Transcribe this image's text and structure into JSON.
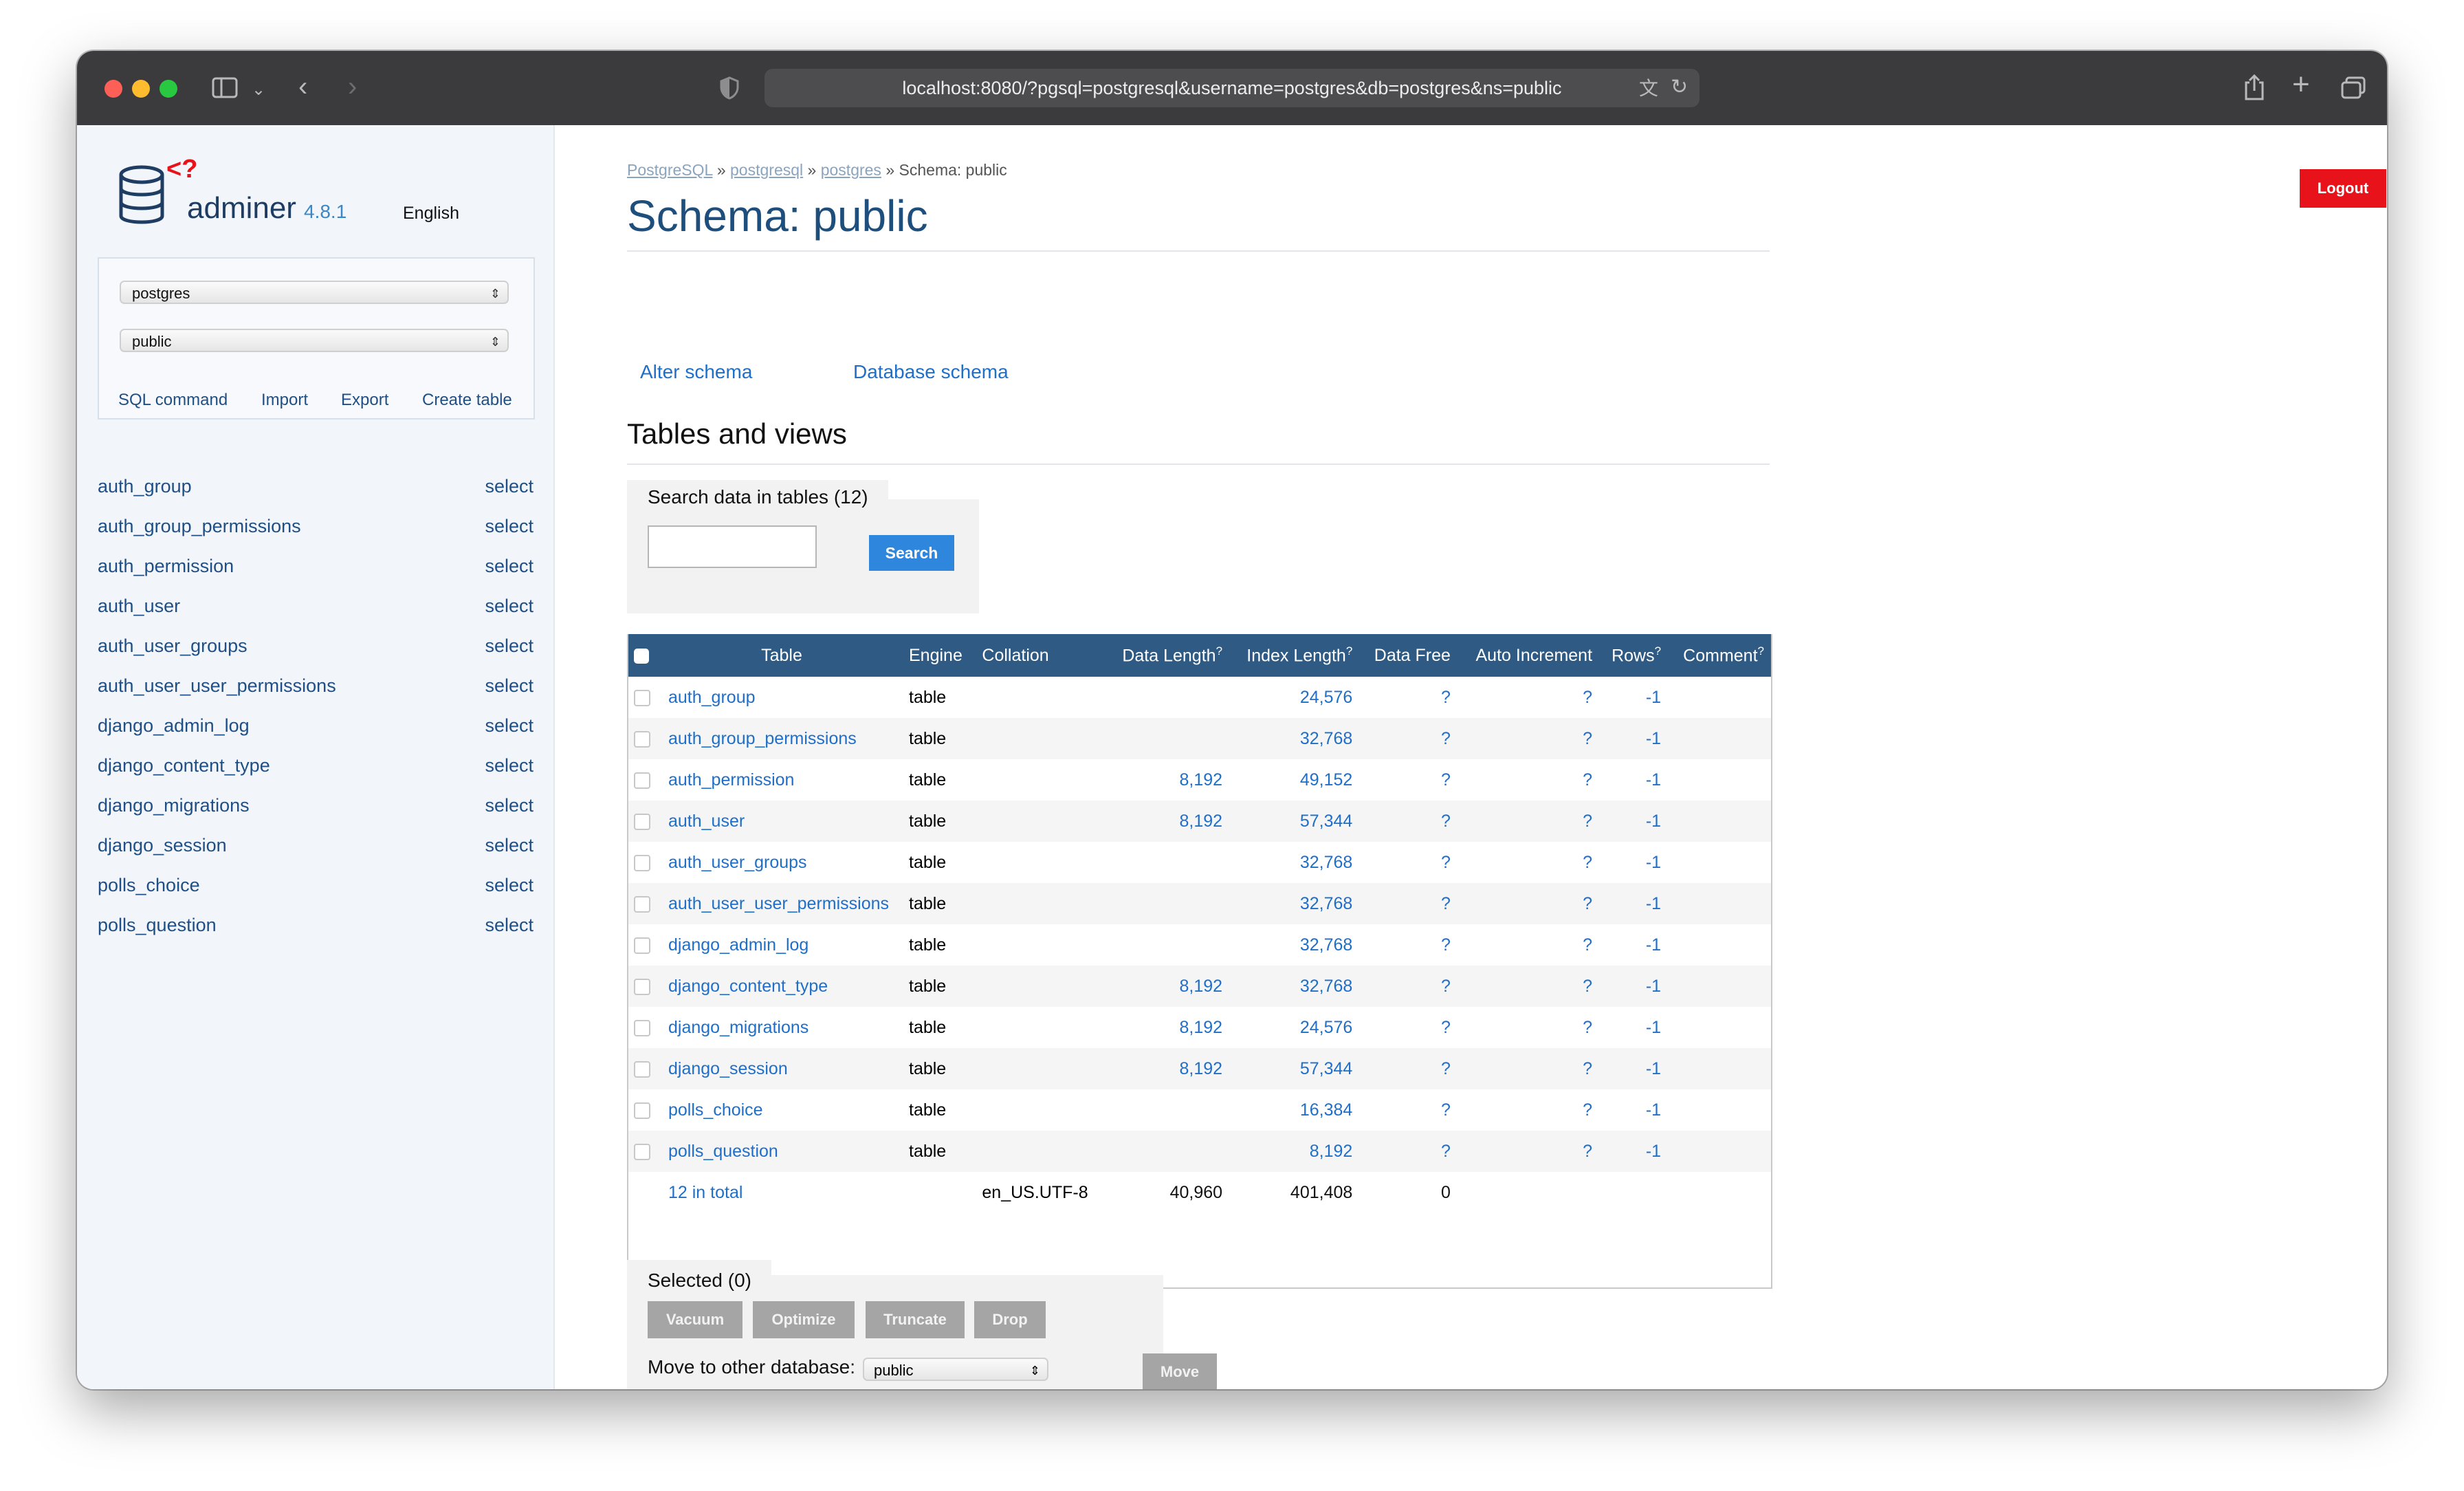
{
  "browser": {
    "url": "localhost:8080/?pgsql=postgresql&username=postgres&db=postgres&ns=public"
  },
  "sidebar": {
    "app_name": "adminer",
    "version": "4.8.1",
    "language": "English",
    "db_select": "postgres",
    "schema_select": "public",
    "links": [
      "SQL command",
      "Import",
      "Export",
      "Create table"
    ],
    "tables": [
      {
        "name": "auth_group",
        "action": "select"
      },
      {
        "name": "auth_group_permissions",
        "action": "select"
      },
      {
        "name": "auth_permission",
        "action": "select"
      },
      {
        "name": "auth_user",
        "action": "select"
      },
      {
        "name": "auth_user_groups",
        "action": "select"
      },
      {
        "name": "auth_user_user_permissions",
        "action": "select"
      },
      {
        "name": "django_admin_log",
        "action": "select"
      },
      {
        "name": "django_content_type",
        "action": "select"
      },
      {
        "name": "django_migrations",
        "action": "select"
      },
      {
        "name": "django_session",
        "action": "select"
      },
      {
        "name": "polls_choice",
        "action": "select"
      },
      {
        "name": "polls_question",
        "action": "select"
      }
    ]
  },
  "main": {
    "breadcrumb": {
      "c1": "PostgreSQL",
      "c2": "postgresql",
      "c3": "postgres",
      "current": "Schema: public",
      "sep": "»"
    },
    "title": "Schema: public",
    "logout": "Logout",
    "actions": [
      "Alter schema",
      "Database schema"
    ],
    "section_title": "Tables and views",
    "search": {
      "title": "Search data in tables (12)",
      "value": "",
      "button": "Search"
    },
    "table": {
      "headers": [
        "Table",
        "Engine",
        "Collation",
        "Data Length",
        "Index Length",
        "Data Free",
        "Auto Increment",
        "Rows",
        "Comment"
      ],
      "sup": "?",
      "rows": [
        {
          "name": "auth_group",
          "engine": "table",
          "data_length": "",
          "index_length": "24,576",
          "data_free": "?",
          "auto_increment": "?",
          "rows": "-1"
        },
        {
          "name": "auth_group_permissions",
          "engine": "table",
          "data_length": "",
          "index_length": "32,768",
          "data_free": "?",
          "auto_increment": "?",
          "rows": "-1"
        },
        {
          "name": "auth_permission",
          "engine": "table",
          "data_length": "8,192",
          "index_length": "49,152",
          "data_free": "?",
          "auto_increment": "?",
          "rows": "-1"
        },
        {
          "name": "auth_user",
          "engine": "table",
          "data_length": "8,192",
          "index_length": "57,344",
          "data_free": "?",
          "auto_increment": "?",
          "rows": "-1"
        },
        {
          "name": "auth_user_groups",
          "engine": "table",
          "data_length": "",
          "index_length": "32,768",
          "data_free": "?",
          "auto_increment": "?",
          "rows": "-1"
        },
        {
          "name": "auth_user_user_permissions",
          "engine": "table",
          "data_length": "",
          "index_length": "32,768",
          "data_free": "?",
          "auto_increment": "?",
          "rows": "-1"
        },
        {
          "name": "django_admin_log",
          "engine": "table",
          "data_length": "",
          "index_length": "32,768",
          "data_free": "?",
          "auto_increment": "?",
          "rows": "-1"
        },
        {
          "name": "django_content_type",
          "engine": "table",
          "data_length": "8,192",
          "index_length": "32,768",
          "data_free": "?",
          "auto_increment": "?",
          "rows": "-1"
        },
        {
          "name": "django_migrations",
          "engine": "table",
          "data_length": "8,192",
          "index_length": "24,576",
          "data_free": "?",
          "auto_increment": "?",
          "rows": "-1"
        },
        {
          "name": "django_session",
          "engine": "table",
          "data_length": "8,192",
          "index_length": "57,344",
          "data_free": "?",
          "auto_increment": "?",
          "rows": "-1"
        },
        {
          "name": "polls_choice",
          "engine": "table",
          "data_length": "",
          "index_length": "16,384",
          "data_free": "?",
          "auto_increment": "?",
          "rows": "-1"
        },
        {
          "name": "polls_question",
          "engine": "table",
          "data_length": "",
          "index_length": "8,192",
          "data_free": "?",
          "auto_increment": "?",
          "rows": "-1"
        }
      ],
      "total": {
        "label": "12 in total",
        "collation": "en_US.UTF-8",
        "data_length": "40,960",
        "index_length": "401,408",
        "data_free": "0"
      }
    },
    "selected": {
      "title": "Selected (0)",
      "buttons": [
        "Vacuum",
        "Optimize",
        "Truncate",
        "Drop"
      ],
      "move_label": "Move to other database:",
      "move_select": "public",
      "move_button": "Move"
    }
  }
}
